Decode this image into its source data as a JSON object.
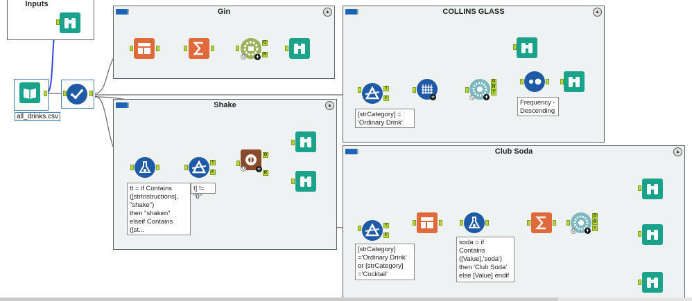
{
  "containers": {
    "inputs": {
      "title": "Inputs"
    },
    "gin": {
      "title": "Gin"
    },
    "collins": {
      "title": "COLLINS GLASS"
    },
    "shake": {
      "title": "Shake"
    },
    "club_soda": {
      "title": "Club Soda"
    }
  },
  "input_tool": {
    "label": "all_drinks.csv"
  },
  "anchors": {
    "true": "T",
    "false": "F",
    "output": "O",
    "relation": "R",
    "dict": "D",
    "r": "R",
    "i": "I"
  },
  "notes": {
    "collins_filter": "[strCategory] =\n'Ordinary Drink'",
    "collins_summary": "Frequency -\nDescending",
    "shake_formula": "tt = if Contains\n([strInstructions],\n\"shake\")\nthen \"shaken\"\nelseif Contains\n([st...",
    "shake_filter_tail": "t] != \"0\"",
    "soda_filter": "[strCategory]\n='Ordinary Drink'\nor [strCategory]\n='Cocktail'",
    "soda_formula": "soda = if\nContains\n([Value],'soda')\nthen 'Club Soda'\nelse [Value] endif"
  },
  "colors": {
    "browse": "#1aa38a",
    "select": "#1f5aa6",
    "formula": "#1f5aa6",
    "orange": "#e06a3c",
    "brown": "#8a4a2c",
    "connector_blue": "#3344dd",
    "connector": "#666666"
  },
  "icons": {
    "browse": "binoculars-icon",
    "input": "book-icon",
    "select": "checkmark-icon",
    "filter": "filter-icon",
    "formula": "flask-icon",
    "summarize": "sigma-icon",
    "text_to_columns": "text-to-columns-icon",
    "ml": "gear-icon",
    "transpose": "transpose-icon",
    "frequency": "dots-icon"
  }
}
